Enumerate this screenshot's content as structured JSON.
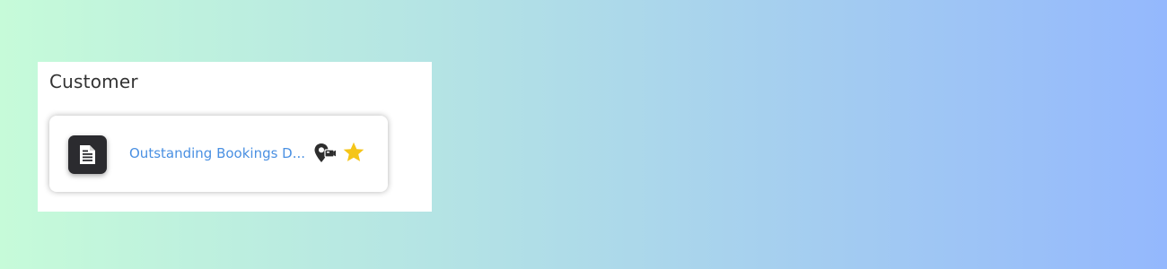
{
  "section": {
    "title": "Customer"
  },
  "card": {
    "label": "Outstanding Bookings D...",
    "icons": [
      "document-icon",
      "location-pin-camera-icon",
      "favorite-star-icon"
    ],
    "colors": {
      "label": "#4a90e2",
      "star": "#f5c518",
      "tile": "#2b2b2f"
    }
  }
}
